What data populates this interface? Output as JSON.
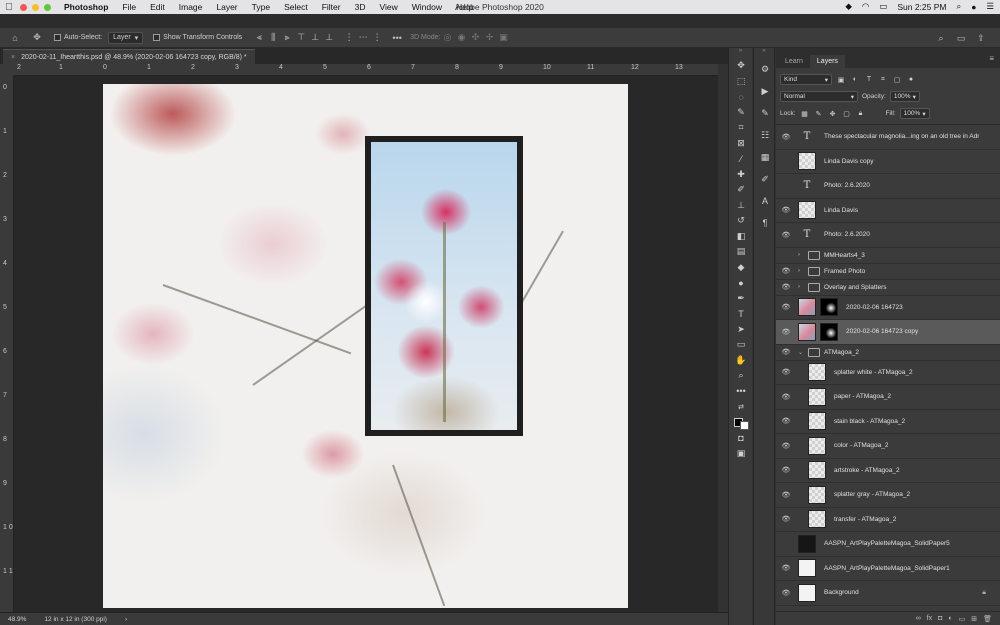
{
  "menubar": {
    "app": "Photoshop",
    "items": [
      "File",
      "Edit",
      "Image",
      "Layer",
      "Type",
      "Select",
      "Filter",
      "3D",
      "View",
      "Window",
      "Help"
    ],
    "window_title": "Adobe Photoshop 2020",
    "clock": "Sun 2:25 PM"
  },
  "options": {
    "auto_select_label": "Auto-Select:",
    "auto_select_value": "Layer",
    "transform_label": "Show Transform Controls",
    "mode_label": "3D Mode:"
  },
  "document": {
    "tab_title": "2020-02-11_Iheartthis.psd @ 48.9% (2020-02-06 164723 copy, RGB/8) *",
    "close": "×"
  },
  "rulers": {
    "h": [
      "2",
      "1",
      "0",
      "1",
      "2",
      "3",
      "4",
      "5",
      "6",
      "7",
      "8",
      "9",
      "10",
      "11",
      "12",
      "13"
    ],
    "v": [
      "0",
      "1",
      "2",
      "3",
      "4",
      "5",
      "6",
      "7",
      "8",
      "9",
      "1 0",
      "1 1"
    ]
  },
  "status": {
    "zoom": "48.9%",
    "doc_size": "12 in x 12 in (300 ppi)"
  },
  "panel": {
    "tabs": [
      "Learn",
      "Layers"
    ],
    "active_tab": "Layers",
    "kind": "Kind",
    "blend_mode": "Normal",
    "opacity_label": "Opacity:",
    "opacity": "100%",
    "lock_label": "Lock:",
    "fill_label": "Fill:",
    "fill": "100%"
  },
  "layers": [
    {
      "name": "These spectacular magnolia...ing on an old tree in Adr",
      "type": "text",
      "visible": true
    },
    {
      "name": "Linda Davis copy",
      "type": "pixel",
      "visible": false
    },
    {
      "name": "Photo: 2.6.2020",
      "type": "text",
      "visible": false
    },
    {
      "name": "Linda Davis",
      "type": "pixel",
      "visible": true
    },
    {
      "name": "Photo: 2.6.2020",
      "type": "text",
      "visible": true
    },
    {
      "name": "MMHearts4_3",
      "type": "group",
      "visible": false
    },
    {
      "name": "Framed Photo",
      "type": "group",
      "visible": true
    },
    {
      "name": "Overlay and Splatters",
      "type": "group",
      "visible": true
    },
    {
      "name": "2020-02-06 164723",
      "type": "photo",
      "visible": true
    },
    {
      "name": "2020-02-06 164723 copy",
      "type": "photo",
      "visible": true,
      "selected": true
    },
    {
      "name": "ATMagoa_2",
      "type": "group-open",
      "visible": true
    },
    {
      "name": "splatter white - ATMagoa_2",
      "type": "pixel",
      "visible": true,
      "indent": true
    },
    {
      "name": "paper - ATMagoa_2",
      "type": "pixel",
      "visible": true,
      "indent": true
    },
    {
      "name": "stain black - ATMagoa_2",
      "type": "pixel",
      "visible": true,
      "indent": true
    },
    {
      "name": "color - ATMagoa_2",
      "type": "pixel",
      "visible": true,
      "indent": true
    },
    {
      "name": "artstroke - ATMagoa_2",
      "type": "pixel",
      "visible": true,
      "indent": true
    },
    {
      "name": "splatter gray - ATMagoa_2",
      "type": "pixel",
      "visible": true,
      "indent": true
    },
    {
      "name": "transfer - ATMagoa_2",
      "type": "pixel",
      "visible": true,
      "indent": true
    },
    {
      "name": "AASPN_ArtPlayPaletteMagoa_SolidPaper5",
      "type": "dark",
      "visible": false
    },
    {
      "name": "AASPN_ArtPlayPaletteMagoa_SolidPaper1",
      "type": "white",
      "visible": true
    },
    {
      "name": "Background",
      "type": "white",
      "visible": true,
      "locked": true
    }
  ]
}
